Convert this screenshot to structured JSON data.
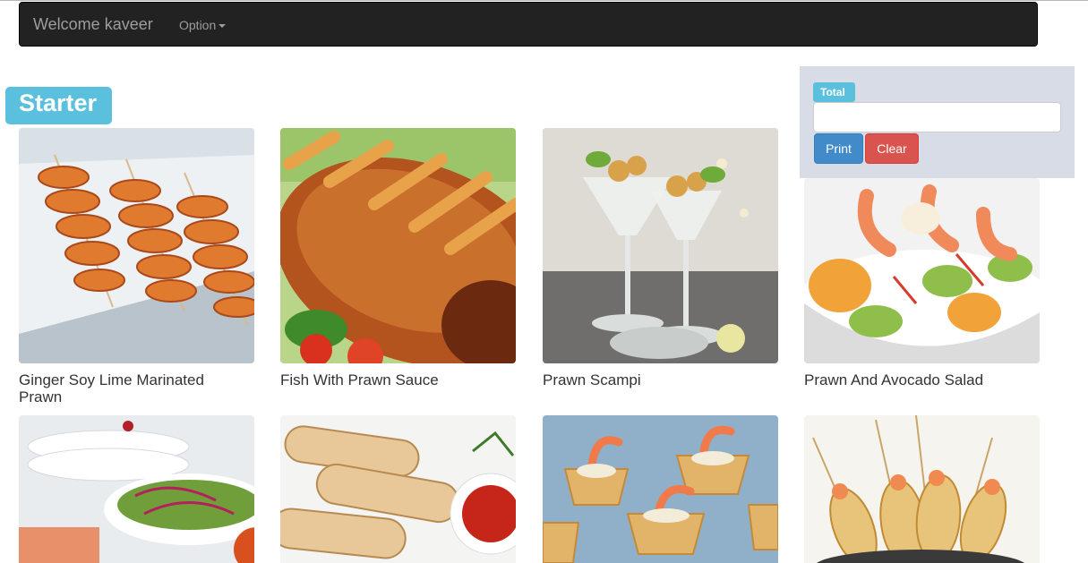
{
  "navbar": {
    "brand": "Welcome kaveer",
    "option_label": "Option"
  },
  "section": {
    "title": "Starter"
  },
  "total_panel": {
    "label": "Total",
    "input_value": "",
    "print_label": "Print",
    "clear_label": "Clear"
  },
  "colors": {
    "navbar_bg": "#222222",
    "label_info": "#5bc0de",
    "button_primary": "#428bca",
    "button_danger": "#d9534f",
    "panel_bg": "#d8dce6"
  },
  "items": [
    {
      "name": "Ginger Soy Lime Marinated Prawn"
    },
    {
      "name": "Fish With Prawn Sauce"
    },
    {
      "name": "Prawn Scampi"
    },
    {
      "name": "Prawn And Avocado Salad"
    }
  ]
}
